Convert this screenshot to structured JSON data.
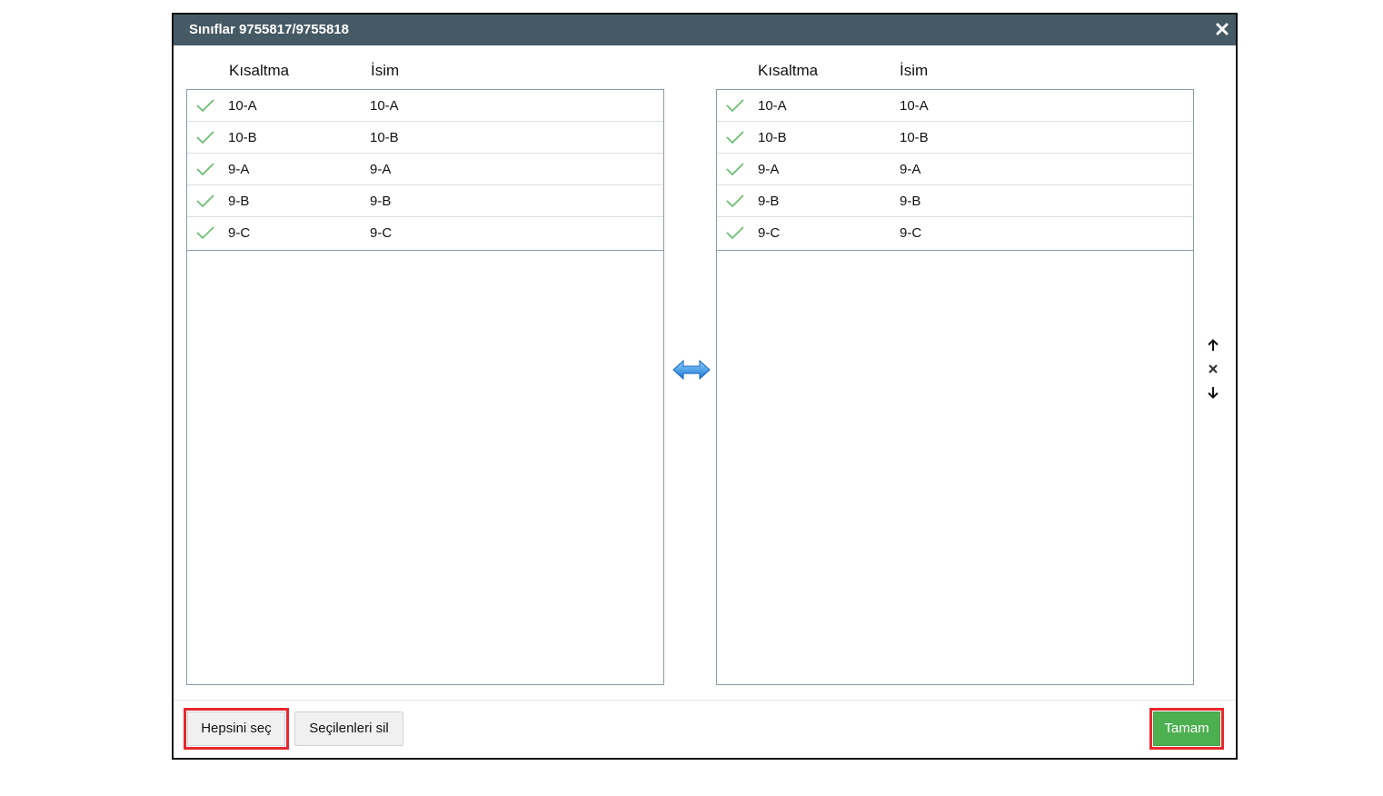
{
  "dialog": {
    "title": "Sınıflar 9755817/9755818",
    "close_icon": "close-icon"
  },
  "left_list": {
    "headers": {
      "abbr": "Kısaltma",
      "name": "İsim"
    },
    "rows": [
      {
        "abbr": "10-A",
        "name": "10-A",
        "checked": true
      },
      {
        "abbr": "10-B",
        "name": "10-B",
        "checked": true
      },
      {
        "abbr": "9-A",
        "name": "9-A",
        "checked": true
      },
      {
        "abbr": "9-B",
        "name": "9-B",
        "checked": true
      },
      {
        "abbr": "9-C",
        "name": "9-C",
        "checked": true
      }
    ]
  },
  "right_list": {
    "headers": {
      "abbr": "Kısaltma",
      "name": "İsim"
    },
    "rows": [
      {
        "abbr": "10-A",
        "name": "10-A",
        "checked": true
      },
      {
        "abbr": "10-B",
        "name": "10-B",
        "checked": true
      },
      {
        "abbr": "9-A",
        "name": "9-A",
        "checked": true
      },
      {
        "abbr": "9-B",
        "name": "9-B",
        "checked": true
      },
      {
        "abbr": "9-C",
        "name": "9-C",
        "checked": true
      }
    ]
  },
  "controls": {
    "swap_icon": "swap-arrows-icon",
    "move_up_icon": "arrow-up-icon",
    "remove_icon": "close-icon",
    "move_down_icon": "arrow-down-icon"
  },
  "footer": {
    "select_all_label": "Hepsini seç",
    "delete_selected_label": "Seçilenleri sil",
    "ok_label": "Tamam"
  },
  "colors": {
    "titlebar": "#455a64",
    "check": "#66bb6a",
    "ok_button": "#4caf50",
    "highlight": "#e8282e",
    "swap_arrow": "#2196f3"
  }
}
